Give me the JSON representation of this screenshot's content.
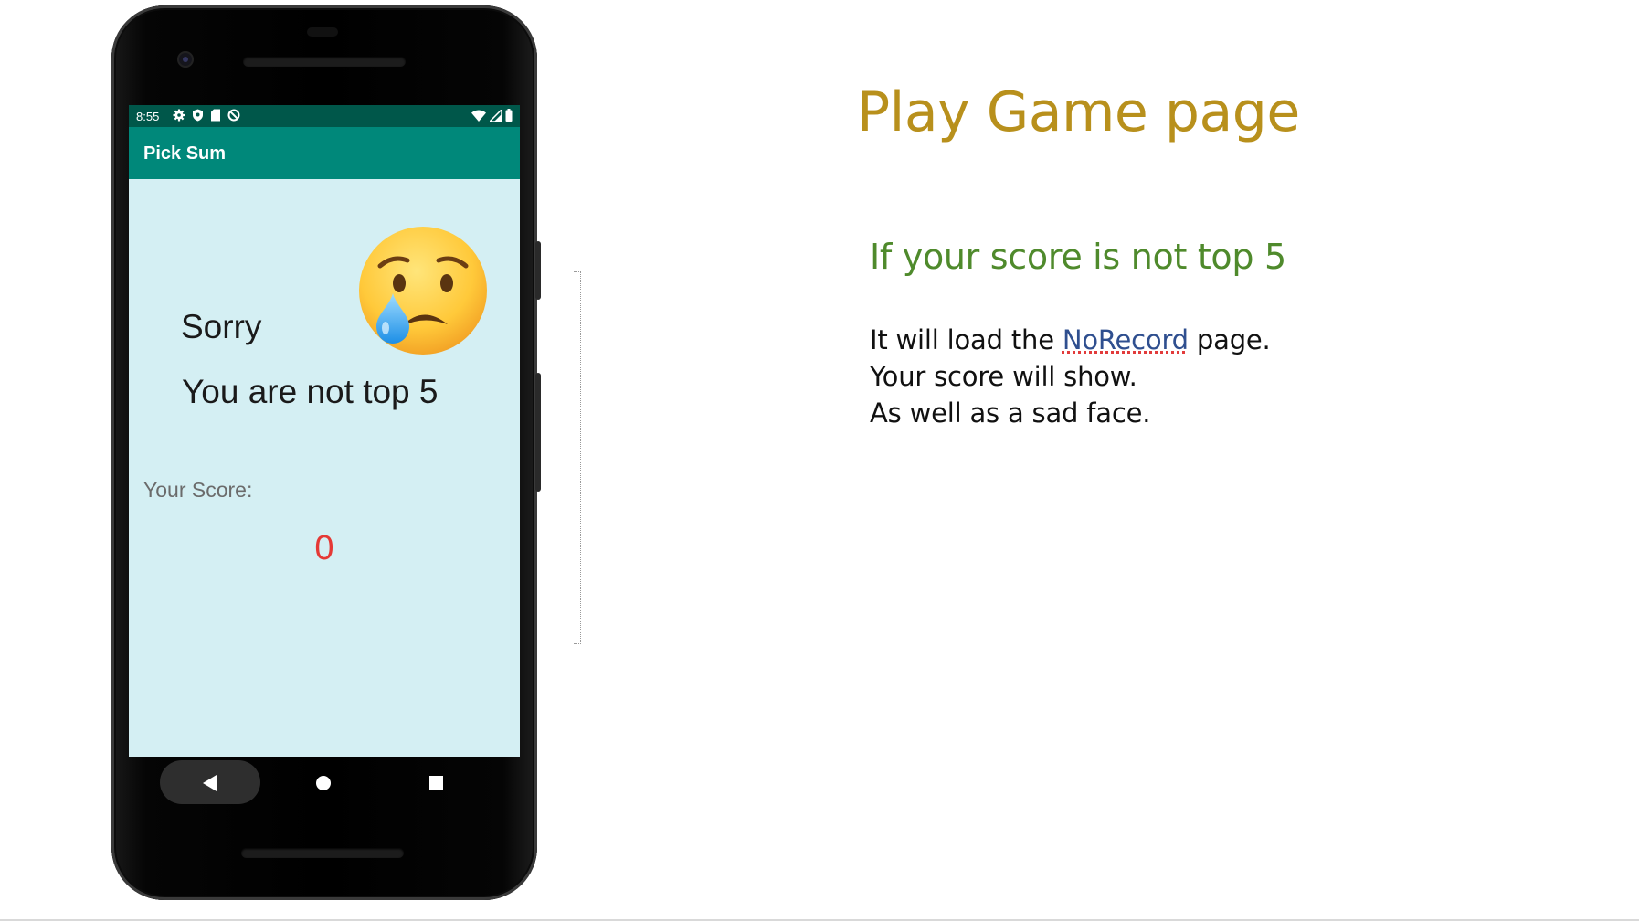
{
  "phone": {
    "status_bar": {
      "time": "8:55",
      "left_icons": [
        "gear-icon",
        "shield-icon",
        "sd-card-icon",
        "data-saver-icon"
      ],
      "right_icons": [
        "wifi-icon",
        "signal-icon",
        "battery-icon"
      ]
    },
    "app_bar": {
      "title": "Pick Sum"
    },
    "screen": {
      "emoji": "crying-face-icon",
      "sorry_text": "Sorry",
      "message_text": "You are not top 5",
      "score_label": "Your Score:",
      "score_value": "0"
    },
    "nav": [
      "back-icon",
      "home-icon",
      "recents-icon"
    ]
  },
  "slide": {
    "title": "Play Game page",
    "subheading": "If your score is not top 5",
    "body": {
      "line1_prefix": "It will load the ",
      "line1_link": "NoRecord",
      "line1_suffix": " page.",
      "line2": "Your score will show.",
      "line3": "As well as a sad face."
    }
  },
  "colors": {
    "status_bar": "#00574a",
    "app_bar": "#00887a",
    "screen_bg": "#d4eff3",
    "score_value": "#e53935",
    "title": "#b8901c",
    "subheading": "#4f8a2c",
    "link": "#2f4f8f"
  }
}
